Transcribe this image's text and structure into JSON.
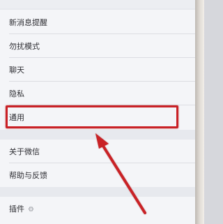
{
  "settings": {
    "items": [
      {
        "label": "新消息提醒"
      },
      {
        "label": "勿扰模式"
      },
      {
        "label": "聊天"
      },
      {
        "label": "隐私"
      },
      {
        "label": "通用"
      },
      {
        "label": "关于微信"
      },
      {
        "label": "帮助与反馈"
      },
      {
        "label": "插件"
      }
    ]
  },
  "plugin_icon": "⚙",
  "colors": {
    "highlight": "#c92126",
    "arrow": "#c92126"
  }
}
